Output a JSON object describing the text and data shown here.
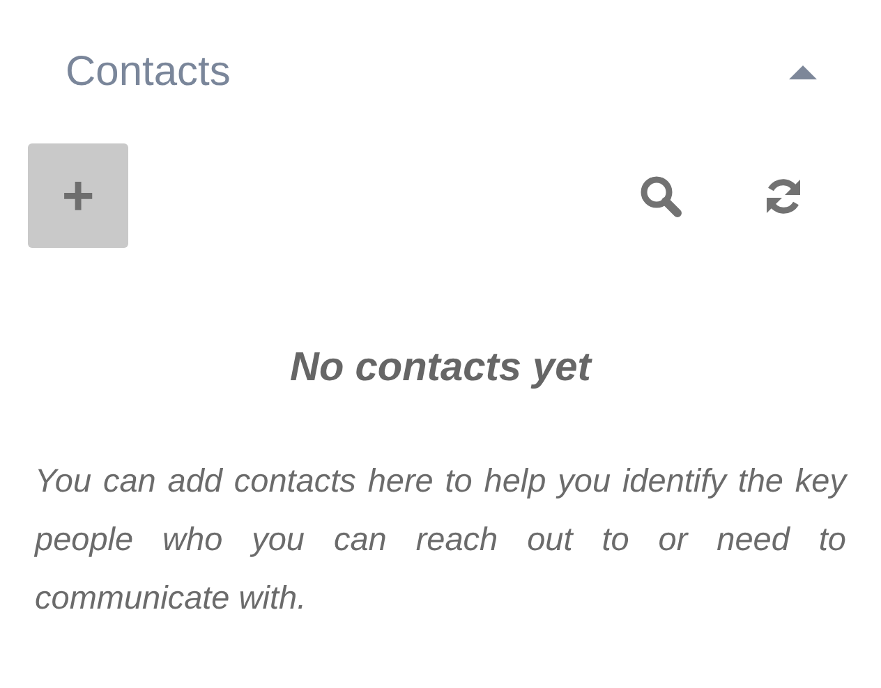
{
  "header": {
    "title": "Contacts",
    "expanded": true
  },
  "toolbar": {
    "add_button": "+"
  },
  "empty_state": {
    "title": "No contacts yet",
    "message": "You can add contacts here to help you identify the key people who you can reach out to or need to communicate with."
  }
}
